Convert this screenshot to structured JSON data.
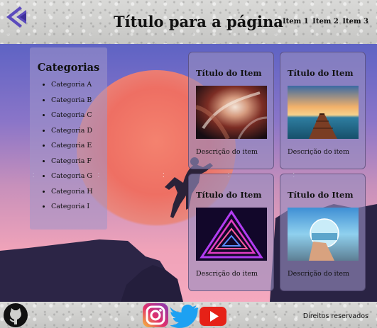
{
  "header": {
    "title": "Título para a página",
    "nav": [
      "Item 1",
      "Item 2",
      "Item 3"
    ]
  },
  "sidebar": {
    "heading": "Categorias",
    "items": [
      "Categoria A",
      "Categoria B",
      "Categoria C",
      "Categoria D",
      "Categoria E",
      "Categoria F",
      "Categoria G",
      "Categoria H",
      "Categoria I"
    ]
  },
  "cards": [
    {
      "title": "Título do Item",
      "description": "Descrição do item",
      "image": "abstract-light-photo"
    },
    {
      "title": "Título do Item",
      "description": "Descrição do item",
      "image": "pier-sunset-photo"
    },
    {
      "title": "Título do Item",
      "description": "Descrição do item",
      "image": "neon-triangle-photo"
    },
    {
      "title": "Título do Item",
      "description": "Descrição do item",
      "image": "crystal-ball-photo"
    }
  ],
  "footer": {
    "rights": "Direitos reservados",
    "icons": [
      "github-icon",
      "instagram-icon",
      "twitter-icon",
      "youtube-icon"
    ]
  },
  "colors": {
    "logo": "#5c4bbd",
    "sky_top": "#5e63c4",
    "sky_bottom": "#f5a9bf",
    "instagram": "#d6336c",
    "twitter": "#1da1f2",
    "youtube": "#e62117"
  }
}
